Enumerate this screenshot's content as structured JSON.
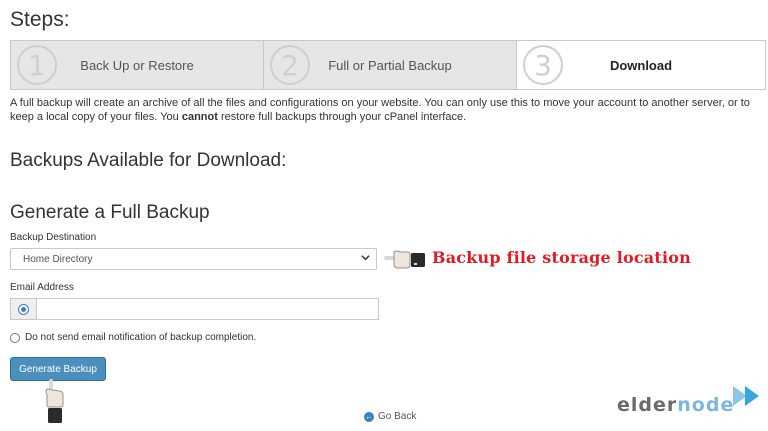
{
  "page": {
    "steps_title": "Steps:",
    "description_before": "A full backup will create an archive of all the files and configurations on your website. You can only use this to move your account to another server, or to keep a local copy of your files. You ",
    "description_bold": "cannot",
    "description_after": " restore full backups through your cPanel interface.",
    "heading_available": "Backups Available for Download:",
    "heading_generate": "Generate a Full Backup"
  },
  "steps": [
    {
      "number": "1",
      "label": "Back Up or Restore",
      "active": false
    },
    {
      "number": "2",
      "label": "Full or Partial Backup",
      "active": false
    },
    {
      "number": "3",
      "label": "Download",
      "active": true
    }
  ],
  "form": {
    "destination_label": "Backup Destination",
    "destination_value": "Home Directory",
    "email_label": "Email Address",
    "email_value": "",
    "no_email_option": "Do not send email notification of backup completion.",
    "generate_button": "Generate Backup",
    "go_back": "Go Back"
  },
  "annotation": {
    "text": "Backup file storage location",
    "color": "#e11b22"
  },
  "logo": {
    "part1": "elder",
    "part2": "node"
  },
  "colors": {
    "button": "#4a8fbe",
    "accent": "#3a7fc6"
  },
  "icons": [
    "pointing-hand-icon",
    "radio-selected-icon",
    "go-back-arrow-icon",
    "chevron-down-icon",
    "play-arrows-icon"
  ]
}
